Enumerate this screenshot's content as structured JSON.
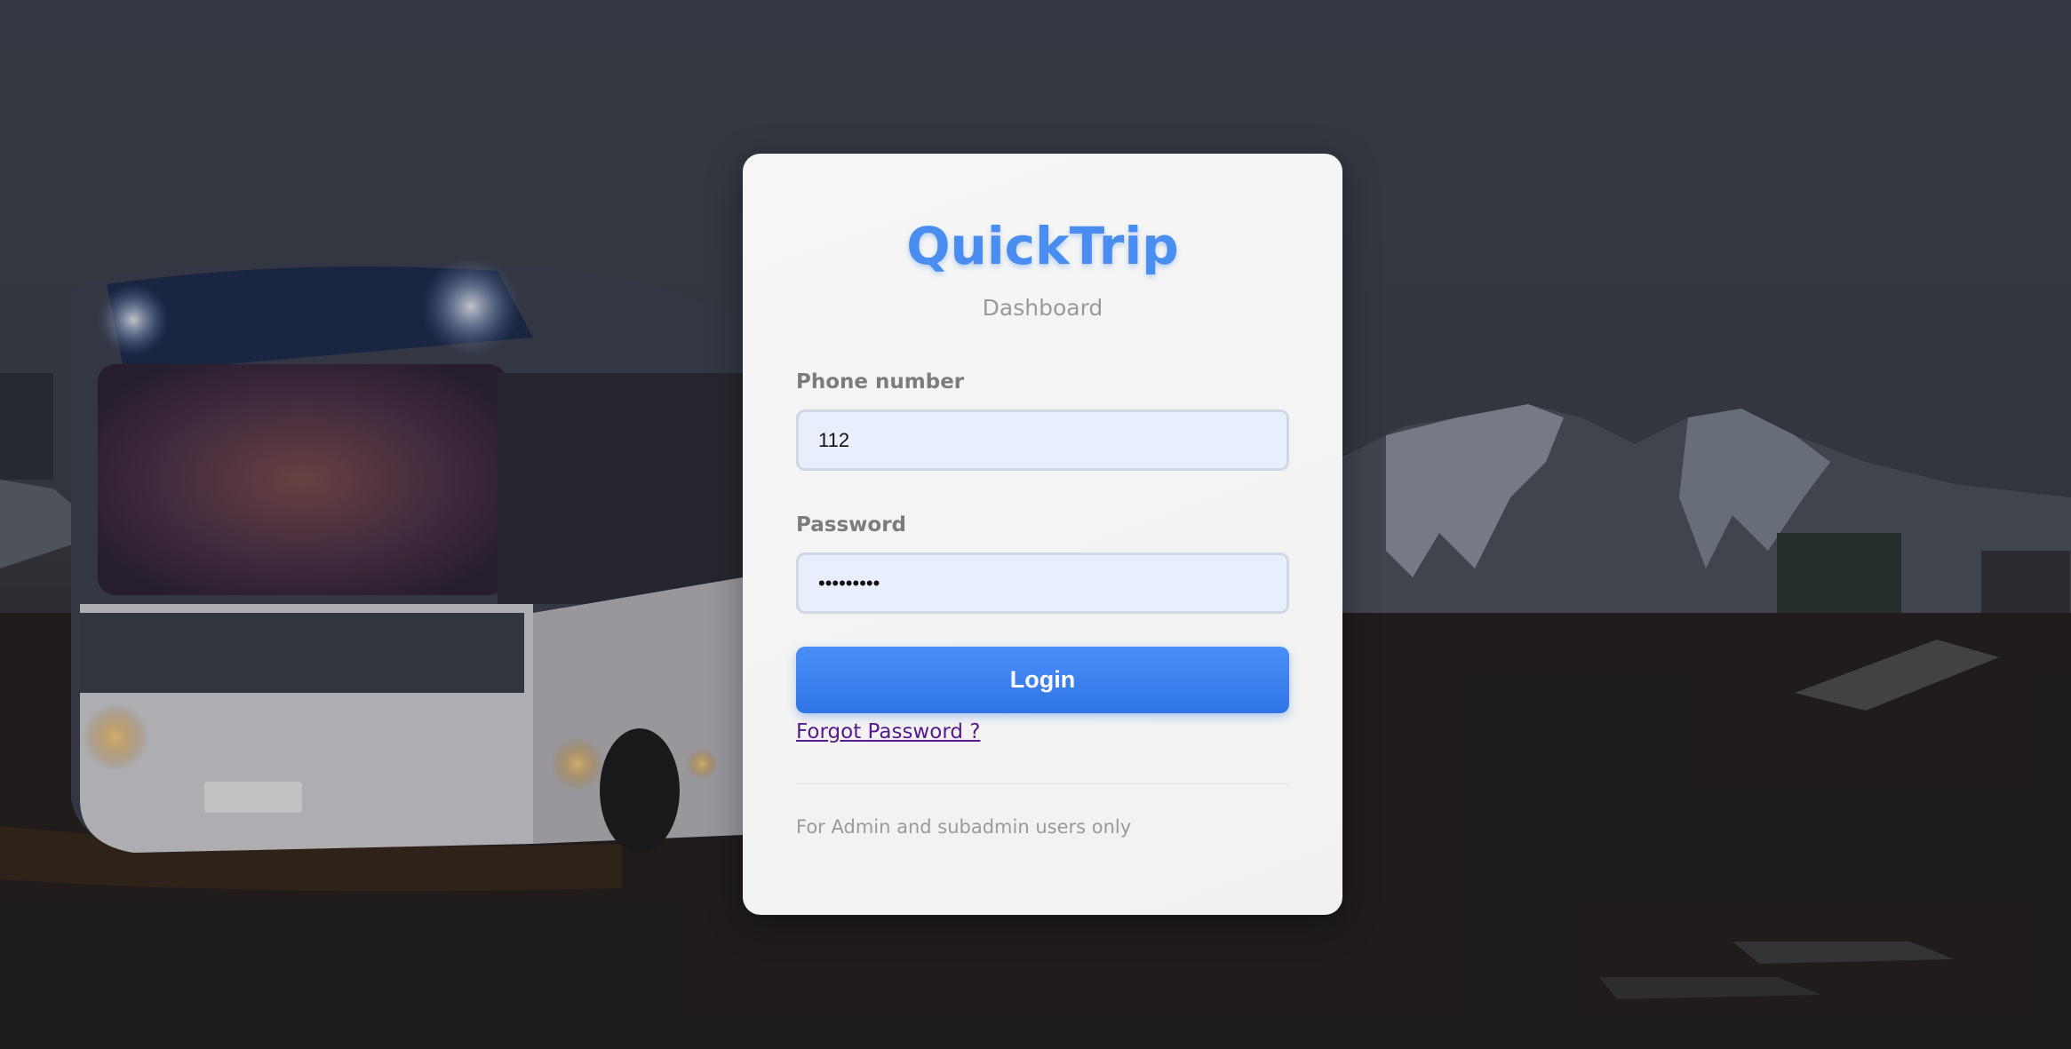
{
  "brand": {
    "title": "QuickTrip",
    "subtitle": "Dashboard"
  },
  "form": {
    "phone": {
      "label": "Phone number",
      "value": "112"
    },
    "password": {
      "label": "Password",
      "value": "•••••••••"
    },
    "login_label": "Login",
    "forgot_label": "Forgot Password ?"
  },
  "footer": {
    "note": "For Admin and subadmin users only"
  },
  "colors": {
    "brand": "#4a8df0",
    "button": "#3b82f0",
    "input_bg": "#e8eefc",
    "link": "#551a8b"
  }
}
